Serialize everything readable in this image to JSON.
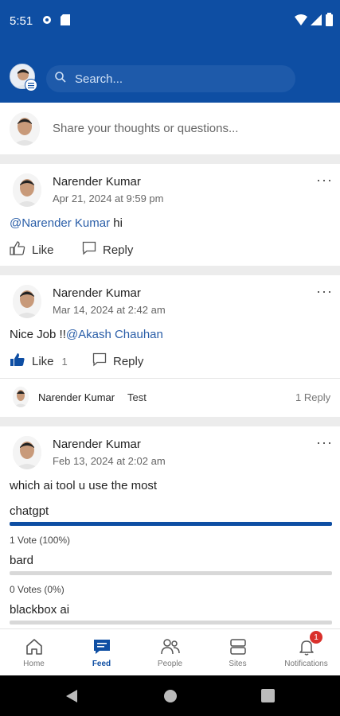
{
  "status": {
    "time": "5:51"
  },
  "search": {
    "placeholder": "Search..."
  },
  "composer": {
    "placeholder": "Share your thoughts or questions..."
  },
  "posts": [
    {
      "author": "Narender Kumar",
      "date": "Apr 21, 2024 at 9:59 pm",
      "mention": "@Narender Kumar",
      "text_after": " hi",
      "like_label": "Like",
      "reply_label": "Reply"
    },
    {
      "author": "Narender Kumar",
      "date": "Mar 14, 2024 at 2:42 am",
      "text_before": "Nice Job !!",
      "mention": "@Akash Chauhan",
      "like_label": "Like",
      "like_count": "1",
      "reply_label": "Reply",
      "reply": {
        "author": "Narender Kumar",
        "text": "Test",
        "count": "1 Reply"
      }
    },
    {
      "author": "Narender Kumar",
      "date": "Feb 13, 2024 at 2:02 am",
      "question": "which ai tool u use the most",
      "options": [
        {
          "label": "chatgpt",
          "votes": "1 Vote (100%)",
          "fraction": 1.0
        },
        {
          "label": "bard",
          "votes": "0 Votes (0%)",
          "fraction": 0.0
        },
        {
          "label": "blackbox ai",
          "fraction": 0.0
        }
      ]
    }
  ],
  "nav": {
    "items": [
      {
        "label": "Home"
      },
      {
        "label": "Feed"
      },
      {
        "label": "People"
      },
      {
        "label": "Sites"
      },
      {
        "label": "Notifications",
        "badge": "1"
      }
    ]
  },
  "colors": {
    "primary": "#0e4ea3",
    "mention": "#2a5ea8",
    "badge": "#d9302b"
  }
}
